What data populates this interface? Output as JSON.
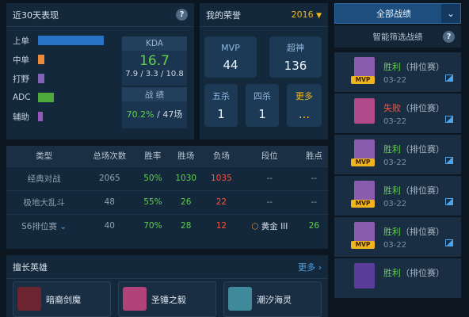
{
  "recent": {
    "title": "近30天表现",
    "help_icon": "?",
    "roles": [
      {
        "label": "上单",
        "fill": 0.85,
        "color": "#2a72c6"
      },
      {
        "label": "中单",
        "fill": 0.08,
        "color": "#ee8b3b"
      },
      {
        "label": "打野",
        "fill": 0.08,
        "color": "#7f64b8"
      },
      {
        "label": "ADC",
        "fill": 0.2,
        "color": "#4ea83a"
      },
      {
        "label": "辅助",
        "fill": 0.05,
        "color": "#9a55b8"
      }
    ],
    "kda": {
      "title": "KDA",
      "value": "16.7",
      "detail": "7.9 / 3.3 / 10.8"
    },
    "record": {
      "title": "战 绩",
      "winrate": "70.2%",
      "games": "/ 47场"
    }
  },
  "honor": {
    "title": "我的荣誉",
    "year": "2016",
    "boxes": [
      {
        "label": "MVP",
        "value": "44"
      },
      {
        "label": "超神",
        "value": "136"
      },
      {
        "label": "五杀",
        "value": "1"
      },
      {
        "label": "四杀",
        "value": "1"
      },
      {
        "label": "更多",
        "value": "..."
      }
    ]
  },
  "stats": {
    "headers": [
      "类型",
      "总场次数",
      "胜率",
      "胜场",
      "负场",
      "段位",
      "胜点"
    ],
    "rows": [
      {
        "type": "经典对战",
        "total": "2065",
        "winrate": "50%",
        "wins": "1030",
        "losses": "1035",
        "rank": "--",
        "points": "--"
      },
      {
        "type": "极地大乱斗",
        "total": "48",
        "winrate": "55%",
        "wins": "26",
        "losses": "22",
        "rank": "--",
        "points": "--"
      },
      {
        "type": "S6排位赛",
        "total": "40",
        "winrate": "70%",
        "wins": "28",
        "losses": "12",
        "rank": "黄金 III",
        "points": "26"
      }
    ]
  },
  "heroes": {
    "title": "擅长英雄",
    "more": "更多",
    "items": [
      {
        "name": "暗裔剑魔",
        "color": "#6b2430"
      },
      {
        "name": "圣锤之毅",
        "color": "#b0447a"
      },
      {
        "name": "潮汐海灵",
        "color": "#3e8a9a"
      }
    ]
  },
  "matches": {
    "filter_label": "全部战绩",
    "smart_filter": "智能筛选战绩",
    "help_icon": "?",
    "items": [
      {
        "result": "胜利",
        "mode": "（排位赛）",
        "date": "03-22",
        "mvp": "MVP",
        "avatar": "#8a5cb0"
      },
      {
        "result": "失败",
        "mode": "（排位赛）",
        "date": "03-22",
        "mvp": "",
        "avatar": "#b04a8a"
      },
      {
        "result": "胜利",
        "mode": "（排位赛）",
        "date": "03-22",
        "mvp": "MVP",
        "avatar": "#8a5cb0"
      },
      {
        "result": "胜利",
        "mode": "（排位赛）",
        "date": "03-22",
        "mvp": "MVP",
        "avatar": "#8a5cb0"
      },
      {
        "result": "胜利",
        "mode": "（排位赛）",
        "date": "03-22",
        "mvp": "MVP",
        "avatar": "#8a5cb0"
      },
      {
        "result": "胜利",
        "mode": "（排位赛）",
        "date": "",
        "mvp": "",
        "avatar": "#5a3c9a"
      }
    ]
  }
}
